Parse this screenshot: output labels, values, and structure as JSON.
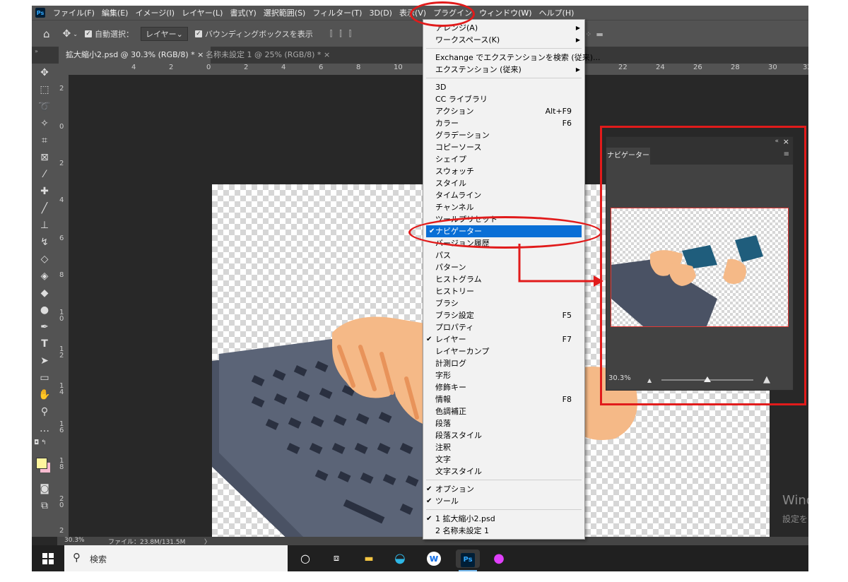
{
  "menubar": {
    "app_icon": "Ps",
    "items": [
      "ファイル(F)",
      "編集(E)",
      "イメージ(I)",
      "レイヤー(L)",
      "書式(Y)",
      "選択範囲(S)",
      "フィルター(T)",
      "3D(D)",
      "表示(V)",
      "プラグイン",
      "ウィンドウ(W)",
      "ヘルプ(H)"
    ]
  },
  "options": {
    "auto_select_label": "自動選択：",
    "auto_select_value": "レイヤー",
    "bbox_label": "バウンディングボックスを表示"
  },
  "tabs": [
    {
      "label": "拡大縮小2.psd @ 30.3% (RGB/8) *"
    },
    {
      "label": "名称未設定 1 @ 25% (RGB/8) *"
    }
  ],
  "ruler_top": [
    "4",
    "2",
    "0",
    "2",
    "4",
    "6",
    "8",
    "10",
    "12",
    "22",
    "24",
    "26",
    "28",
    "30",
    "32"
  ],
  "ruler_left": [
    "2",
    "0",
    "2",
    "4",
    "6",
    "8",
    "1 0",
    "1 2",
    "1 4",
    "1 6",
    "1 8",
    "2 0",
    "2"
  ],
  "status": {
    "zoom": "30.3%",
    "file": "ファイル：23.8M/131.5M",
    "arrow": "〉"
  },
  "window_menu": {
    "items": [
      {
        "label": "アレンジ(A)",
        "submenu": true
      },
      {
        "label": "ワークスペース(K)",
        "submenu": true
      },
      {
        "label": "Exchange でエクステンションを検索 (従来)..."
      },
      {
        "label": "エクステンション (従来)",
        "submenu": true
      },
      {
        "label": "3D"
      },
      {
        "label": "CC ライブラリ"
      },
      {
        "label": "アクション",
        "shortcut": "Alt+F9"
      },
      {
        "label": "カラー",
        "shortcut": "F6"
      },
      {
        "label": "グラデーション"
      },
      {
        "label": "コピーソース"
      },
      {
        "label": "シェイプ"
      },
      {
        "label": "スウォッチ"
      },
      {
        "label": "スタイル"
      },
      {
        "label": "タイムライン"
      },
      {
        "label": "チャンネル"
      },
      {
        "label": "ツールプリセット"
      },
      {
        "label": "ナビゲーター",
        "checked": true,
        "highlighted": true
      },
      {
        "label": "バージョン履歴"
      },
      {
        "label": "パス"
      },
      {
        "label": "パターン"
      },
      {
        "label": "ヒストグラム"
      },
      {
        "label": "ヒストリー"
      },
      {
        "label": "ブラシ"
      },
      {
        "label": "ブラシ設定",
        "shortcut": "F5"
      },
      {
        "label": "プロパティ"
      },
      {
        "label": "レイヤー",
        "shortcut": "F7",
        "checked": true
      },
      {
        "label": "レイヤーカンプ"
      },
      {
        "label": "計測ログ"
      },
      {
        "label": "字形"
      },
      {
        "label": "修飾キー"
      },
      {
        "label": "情報",
        "shortcut": "F8"
      },
      {
        "label": "色調補正"
      },
      {
        "label": "段落"
      },
      {
        "label": "段落スタイル"
      },
      {
        "label": "注釈"
      },
      {
        "label": "文字"
      },
      {
        "label": "文字スタイル"
      },
      {
        "label": "オプション",
        "checked": true
      },
      {
        "label": "ツール",
        "checked": true
      },
      {
        "label": "1 拡大縮小2.psd",
        "checked": true
      },
      {
        "label": "2 名称未設定 1"
      }
    ]
  },
  "navigator": {
    "title": "ナビゲーター",
    "zoom": "30.3%",
    "zoom_level": 0.5
  },
  "watermark": {
    "line1": "Wind",
    "line2": "設定を"
  },
  "taskbar": {
    "search_label": "検索",
    "icons": [
      "windows-start-icon",
      "cortana-icon",
      "task-view-icon",
      "file-explorer-icon",
      "edge-icon",
      "w-app-icon",
      "photoshop-icon",
      "color-drop-icon"
    ],
    "ps_label": "Ps",
    "w_label": "w"
  },
  "colors": {
    "highlight": "#0a6fd6",
    "annotation": "#e11b1b",
    "foreground_swatch": "#fff59d",
    "background_swatch": "#f8bbd0"
  }
}
